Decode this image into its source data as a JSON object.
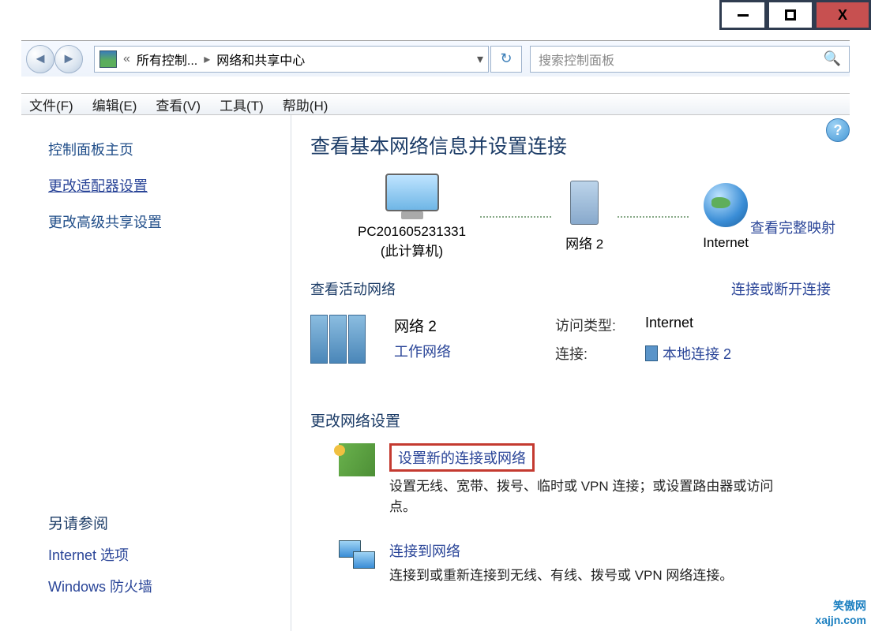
{
  "window": {
    "minimize": "—",
    "maximize": "□",
    "close": "X"
  },
  "address": {
    "segment1": "所有控制...",
    "segment2": "网络和共享中心",
    "prefix": "«"
  },
  "search": {
    "placeholder": "搜索控制面板"
  },
  "menu": {
    "file": "文件(F)",
    "edit": "编辑(E)",
    "view": "查看(V)",
    "tools": "工具(T)",
    "help": "帮助(H)"
  },
  "sidebar": {
    "home": "控制面板主页",
    "adapter": "更改适配器设置",
    "advanced": "更改高级共享设置",
    "see_also_title": "另请参阅",
    "internet_options": "Internet 选项",
    "firewall": "Windows 防火墙"
  },
  "content": {
    "title": "查看基本网络信息并设置连接",
    "full_map": "查看完整映射",
    "pc_name": "PC201605231331",
    "this_pc": "(此计算机)",
    "net_device": "网络 2",
    "internet": "Internet",
    "active_header": "查看活动网络",
    "conn_disc": "连接或断开连接",
    "net2_name": "网络 2",
    "net2_type": "工作网络",
    "access_label": "访问类型:",
    "access_value": "Internet",
    "conn_label": "连接:",
    "conn_value": "本地连接 2",
    "change_title": "更改网络设置",
    "opt1_title": "设置新的连接或网络",
    "opt1_desc": "设置无线、宽带、拨号、临时或 VPN 连接；或设置路由器或访问点。",
    "opt2_title": "连接到网络",
    "opt2_desc": "连接到或重新连接到无线、有线、拨号或 VPN 网络连接。"
  },
  "watermark": {
    "line1": "笑傲网",
    "line2": "xajjn.com"
  }
}
